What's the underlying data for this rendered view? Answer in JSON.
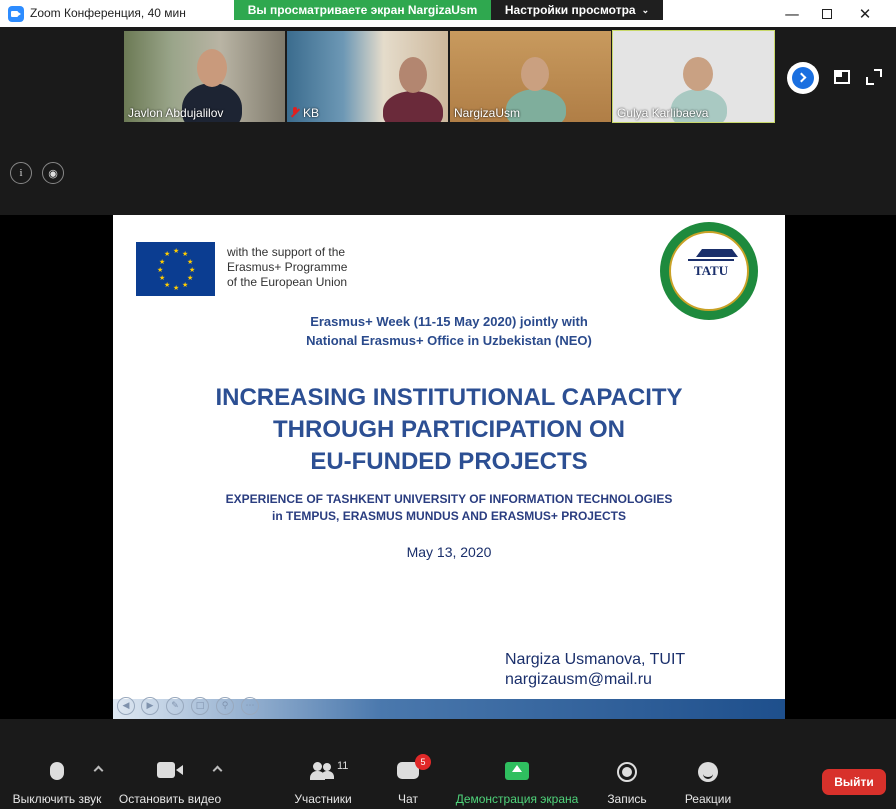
{
  "window": {
    "title": "Zoom Конференция, 40 мин",
    "share_banner": "Вы просматриваете экран NargizaUsm",
    "view_options": "Настройки просмотра"
  },
  "participants_strip": [
    {
      "name": "Javlon Abdujalilov",
      "muted": false
    },
    {
      "name": "KB",
      "muted": true
    },
    {
      "name": "NargizaUsm",
      "muted": false
    },
    {
      "name": "Gulya Karlibaeva",
      "muted": false
    }
  ],
  "slide": {
    "eu_support": [
      "with the support of the",
      "Erasmus+ Programme",
      "of the European Union"
    ],
    "logo_text": "TATU",
    "week": [
      "Erasmus+ Week (11-15 May 2020) jointly with",
      "National Erasmus+ Office in Uzbekistan (NEO)"
    ],
    "title": [
      "INCREASING INSTITUTIONAL CAPACITY",
      "THROUGH PARTICIPATION ON",
      "EU-FUNDED PROJECTS"
    ],
    "subtitle": [
      "EXPERIENCE OF TASHKENT UNIVERSITY OF INFORMATION TECHNOLOGIES",
      "in TEMPUS, ERASMUS MUNDUS AND ERASMUS+  PROJECTS"
    ],
    "date": "May 13, 2020",
    "author": "Nargiza Usmanova, TUIT",
    "email": "nargizausm@mail.ru"
  },
  "toolbar": {
    "mute": "Выключить звук",
    "video": "Остановить видео",
    "participants": "Участники",
    "participants_count": "11",
    "chat": "Чат",
    "chat_badge": "5",
    "share": "Демонстрация экрана",
    "record": "Запись",
    "reactions": "Реакции",
    "leave": "Выйти"
  },
  "colors": {
    "share_green": "#2fa84f",
    "leave_red": "#d8312b",
    "slide_title_blue": "#2c4f93"
  }
}
